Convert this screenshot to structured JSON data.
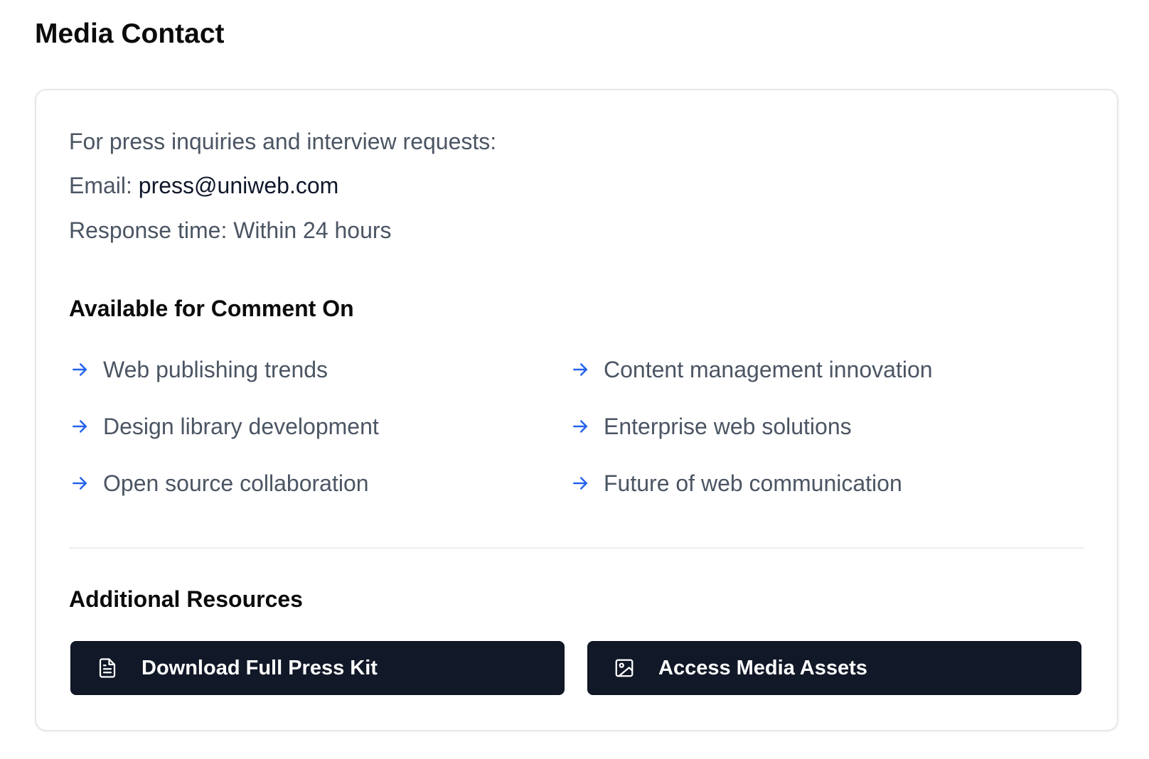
{
  "page": {
    "title": "Media Contact"
  },
  "contact": {
    "intro": "For press inquiries and interview requests:",
    "email_label": "Email:",
    "email_value": "press@uniweb.com",
    "response_time": "Response time: Within 24 hours"
  },
  "comment": {
    "heading": "Available for Comment On",
    "icon": "arrow-right-icon",
    "topics": [
      "Web publishing trends",
      "Content management innovation",
      "Design library development",
      "Enterprise web solutions",
      "Open source collaboration",
      "Future of web communication"
    ]
  },
  "resources": {
    "heading": "Additional Resources",
    "buttons": [
      {
        "label": "Download Full Press Kit",
        "icon": "document-icon"
      },
      {
        "label": "Access Media Assets",
        "icon": "image-icon"
      }
    ]
  },
  "colors": {
    "accent": "#2563eb",
    "button_bg": "#111827",
    "muted_text": "#4b5563"
  }
}
